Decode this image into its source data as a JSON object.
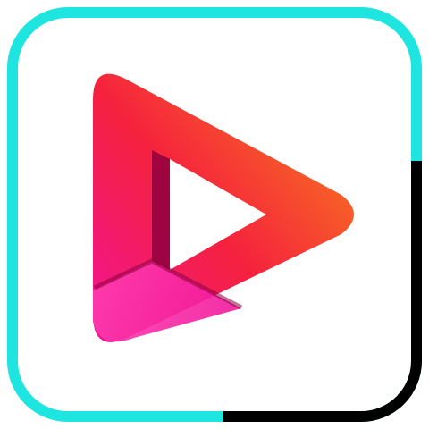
{
  "icon": {
    "name": "play-icon",
    "colors": {
      "frame_primary": "#1FE5E0",
      "frame_accent": "#000000",
      "background": "#FFFFFF",
      "gradient_pink": "#F0149A",
      "gradient_red": "#F5213E",
      "gradient_orange": "#F8761E",
      "fold_shadow": "#8E0040",
      "fold_light": "#FF3FB0"
    }
  }
}
